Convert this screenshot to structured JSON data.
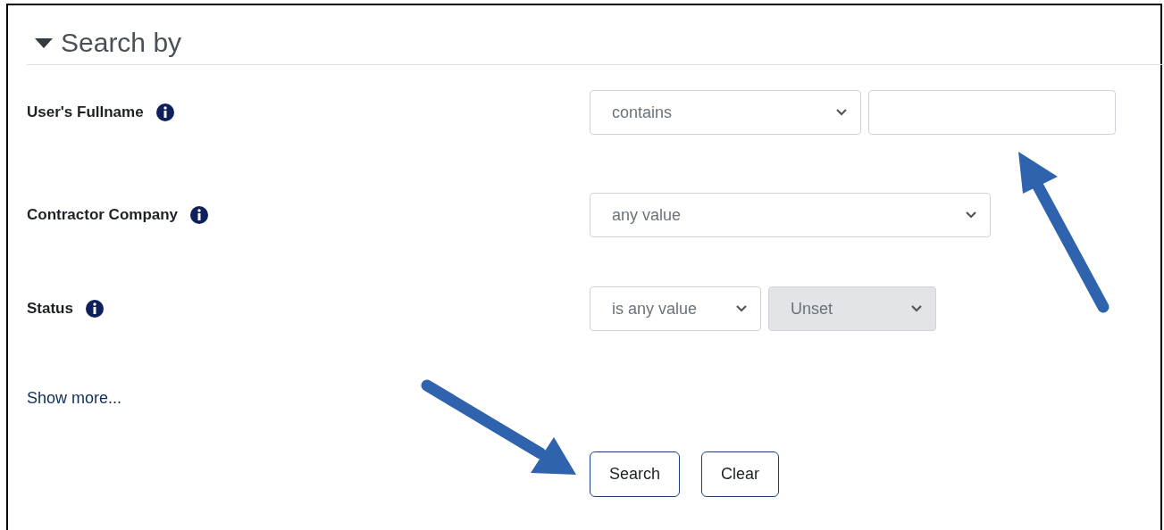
{
  "heading": {
    "label": "Search by",
    "expanded": true
  },
  "filters": [
    {
      "label": "User's Fullname",
      "controls": [
        {
          "kind": "select",
          "value": "contains",
          "disabled": false
        },
        {
          "kind": "text"
        }
      ]
    },
    {
      "label": "Contractor Company",
      "controls": [
        {
          "kind": "select",
          "value": "any value",
          "disabled": false
        }
      ]
    },
    {
      "label": "Status",
      "controls": [
        {
          "kind": "select",
          "value": "is any value",
          "disabled": false
        },
        {
          "kind": "select",
          "value": "Unset",
          "disabled": true
        }
      ]
    }
  ],
  "show_more": "Show more...",
  "buttons": [
    "Search",
    "Clear"
  ]
}
